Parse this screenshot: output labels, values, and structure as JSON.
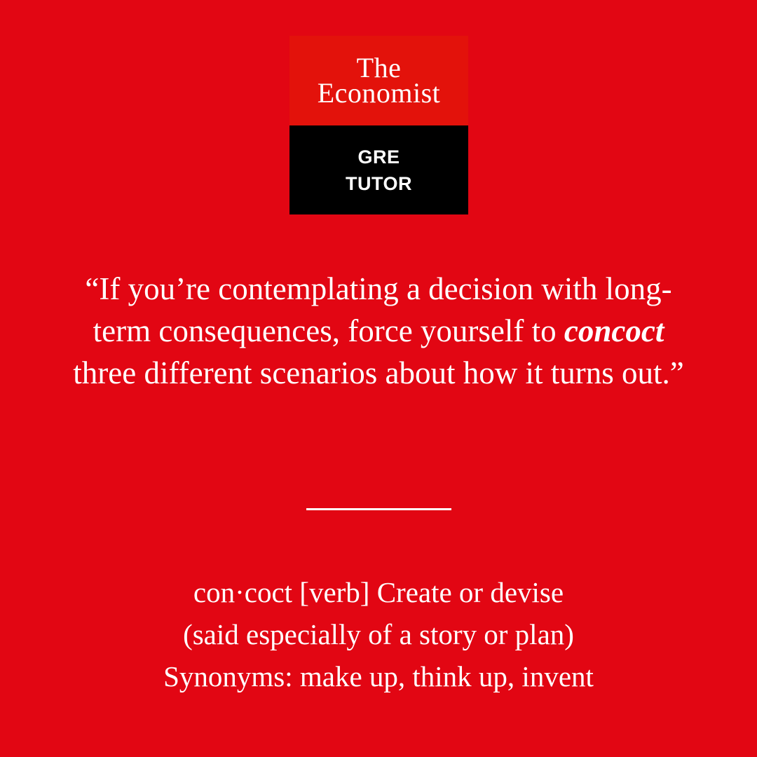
{
  "brand": {
    "line1": "The",
    "line2": "Economist",
    "sub_line1": "GRE",
    "sub_line2": "TUTOR"
  },
  "quote": {
    "before": "“If you’re contemplating a decision with long-term consequences, force yourself to ",
    "term": "concoct",
    "after": " three different scenarios about how it turns out.”"
  },
  "definition": {
    "line1": "con·coct [verb] Create or devise",
    "line2": "(said especially of a story or plan)",
    "line3": "Synonyms: make up, think up, invent"
  },
  "colors": {
    "background": "#e20613",
    "logo_top": "#e3120b",
    "logo_bottom": "#000000",
    "text": "#ffffff"
  }
}
